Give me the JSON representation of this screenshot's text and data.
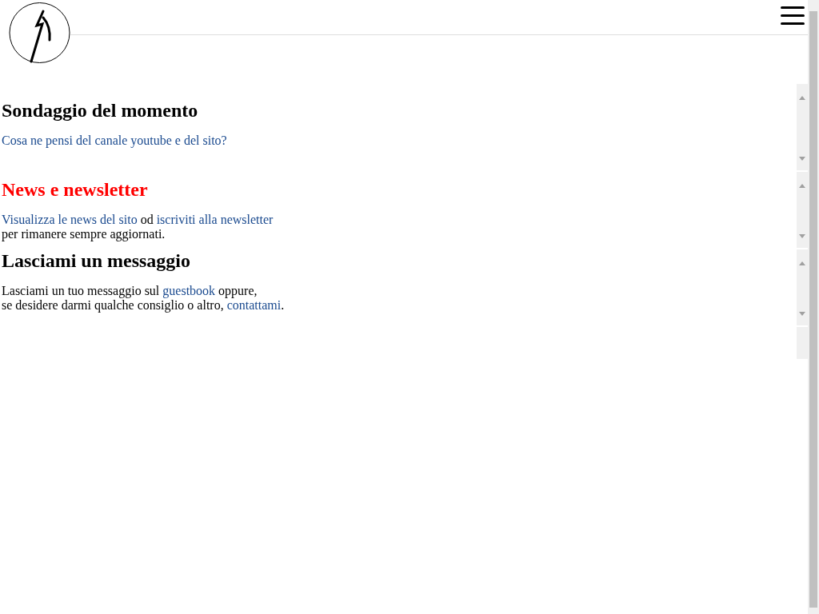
{
  "sections": [
    {
      "title": "Sondaggio del momento",
      "highlighted": false,
      "lines": [
        [
          {
            "kind": "link",
            "text": "Cosa ne pensi del canale youtube e del sito?"
          }
        ]
      ]
    },
    {
      "title": "News e newsletter",
      "highlighted": true,
      "lines": [
        [
          {
            "kind": "link",
            "text": "Visualizza le news del sito"
          },
          {
            "kind": "text",
            "text": " od "
          },
          {
            "kind": "link",
            "text": "iscriviti alla newsletter"
          }
        ],
        [
          {
            "kind": "text",
            "text": "per rimanere sempre aggiornati."
          }
        ]
      ]
    },
    {
      "title": "Lasciami un messaggio",
      "highlighted": false,
      "lines": [
        [
          {
            "kind": "text",
            "text": "Lasciami un tuo messaggio sul "
          },
          {
            "kind": "link",
            "text": "guestbook"
          },
          {
            "kind": "text",
            "text": " oppure,"
          }
        ],
        [
          {
            "kind": "text",
            "text": "se desidere darmi qualche consiglio o altro, "
          },
          {
            "kind": "link",
            "text": "contattami"
          },
          {
            "kind": "text",
            "text": "."
          }
        ]
      ]
    }
  ]
}
